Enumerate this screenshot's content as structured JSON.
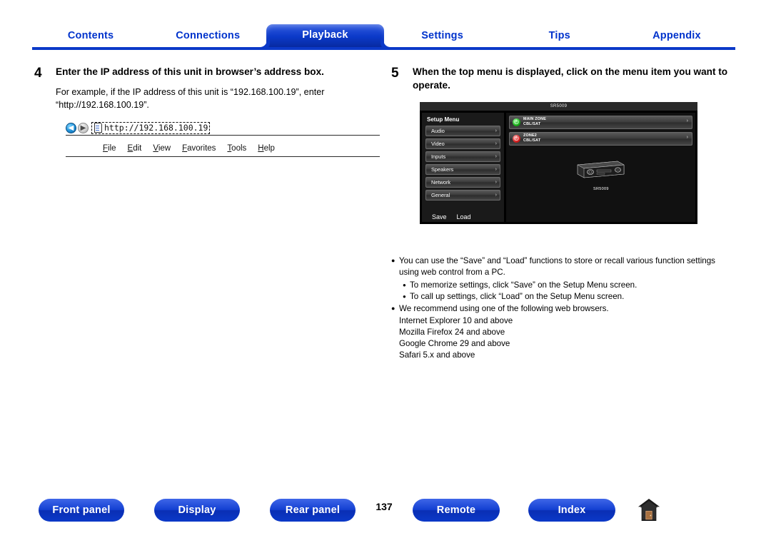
{
  "topnav": {
    "tabs": [
      {
        "label": "Contents",
        "active": false
      },
      {
        "label": "Connections",
        "active": false
      },
      {
        "label": "Playback",
        "active": true
      },
      {
        "label": "Settings",
        "active": false
      },
      {
        "label": "Tips",
        "active": false
      },
      {
        "label": "Appendix",
        "active": false
      }
    ],
    "accent_color": "#0b39c8"
  },
  "step4": {
    "number": "4",
    "title": "Enter the IP address of this unit in browser’s address box.",
    "body": "For example, if the IP address of this unit is “192.168.100.19”, enter “http://192.168.100.19”.",
    "browser": {
      "back_icon": "back-arrow-icon",
      "forward_icon": "forward-arrow-icon",
      "url_value": "http://192.168.100.19",
      "menu_items": [
        "File",
        "Edit",
        "View",
        "Favorites",
        "Tools",
        "Help"
      ]
    }
  },
  "step5": {
    "number": "5",
    "title": "When the top menu is displayed, click on the menu item you want to operate.",
    "screen": {
      "title_bar": "SR5009",
      "setup_menu_label": "Setup Menu",
      "menu_items": [
        "Audio",
        "Video",
        "Inputs",
        "Speakers",
        "Network",
        "General"
      ],
      "footer_buttons": [
        "Save",
        "Load"
      ],
      "zones": [
        {
          "name": "MAIN ZONE",
          "source": "CBL/SAT",
          "power": "on",
          "power_color": "#19b019"
        },
        {
          "name": "ZONE2",
          "source": "CBL/SAT",
          "power": "off",
          "power_color": "#d62020"
        }
      ],
      "device_model": "SR5009"
    }
  },
  "notes": {
    "items": [
      "You can use the “Save” and “Load” functions to store or recall various function settings using web control from a PC.",
      "We recommend using one of the following web browsers."
    ],
    "subitems": [
      "To memorize settings, click “Save” on the Setup Menu screen.",
      "To call up settings, click “Load” on the Setup Menu screen."
    ],
    "browsers": [
      "Internet Explorer 10 and above",
      "Mozilla Firefox 24 and above",
      "Google Chrome 29 and above",
      "Safari 5.x and above"
    ]
  },
  "bottombar": {
    "buttons": [
      "Front panel",
      "Display",
      "Rear panel",
      "Remote",
      "Index"
    ],
    "page_number": "137",
    "home_icon": "home-icon"
  }
}
